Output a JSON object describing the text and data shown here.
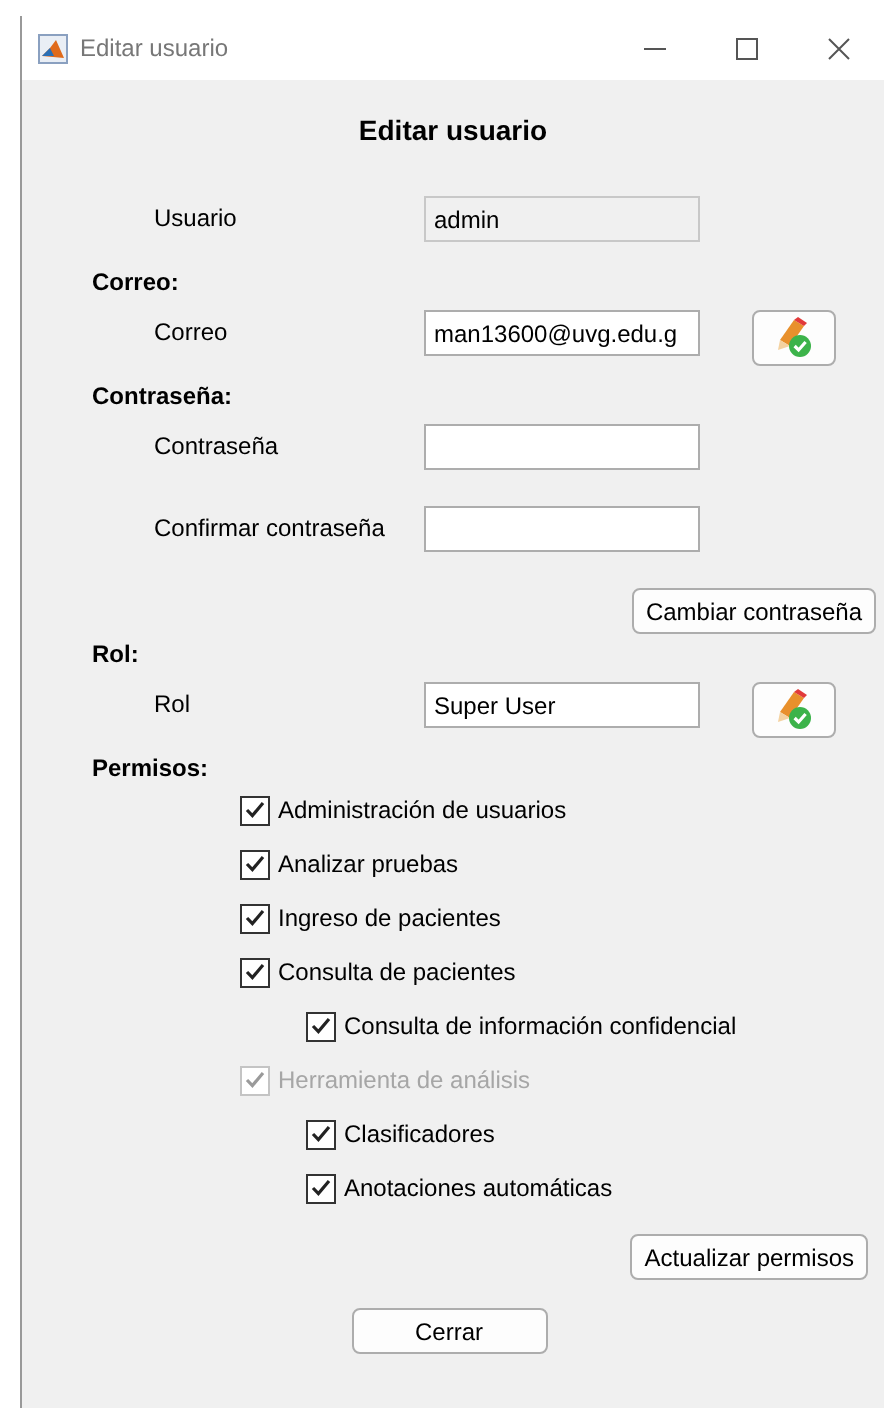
{
  "window": {
    "title": "Editar usuario"
  },
  "heading": "Editar usuario",
  "rows": [
    {
      "kind": "field",
      "label": "Usuario",
      "value": "admin",
      "disabled": true,
      "edit_button": false
    },
    {
      "kind": "section",
      "title": "Correo:"
    },
    {
      "kind": "field",
      "label": "Correo",
      "value": "man13600@uvg.edu.g",
      "disabled": false,
      "edit_button": true
    },
    {
      "kind": "section",
      "title": "Contraseña:"
    },
    {
      "kind": "field",
      "label": "Contraseña",
      "disabled": false,
      "edit_button": false
    },
    {
      "kind": "field",
      "label": "Confirmar contraseña",
      "disabled": false,
      "edit_button": false
    },
    {
      "kind": "button",
      "label": "Cambiar contraseña"
    },
    {
      "kind": "section",
      "title": "Rol:"
    },
    {
      "kind": "field",
      "label": "Rol",
      "value": "Super User",
      "disabled": false,
      "edit_button": true
    },
    {
      "kind": "section",
      "title": "Permisos:"
    },
    {
      "kind": "checklist",
      "items": [
        {
          "label": "Administración de usuarios",
          "checked": true,
          "disabled": false
        },
        {
          "label": "Analizar pruebas",
          "checked": true,
          "disabled": false
        },
        {
          "label": "Ingreso de pacientes",
          "checked": true,
          "disabled": false
        },
        {
          "label": "Consulta de pacientes",
          "checked": true,
          "disabled": false,
          "children": [
            {
              "label": "Consulta de información confidencial",
              "checked": true,
              "disabled": false
            }
          ]
        },
        {
          "label": "Herramienta de análisis",
          "checked": true,
          "disabled": true,
          "children": [
            {
              "label": "Clasificadores",
              "checked": true,
              "disabled": false
            },
            {
              "label": "Anotaciones automáticas",
              "checked": true,
              "disabled": false
            }
          ]
        }
      ]
    },
    {
      "kind": "button",
      "label": "Actualizar permisos"
    },
    {
      "kind": "footer-button",
      "label": "Cerrar"
    }
  ]
}
